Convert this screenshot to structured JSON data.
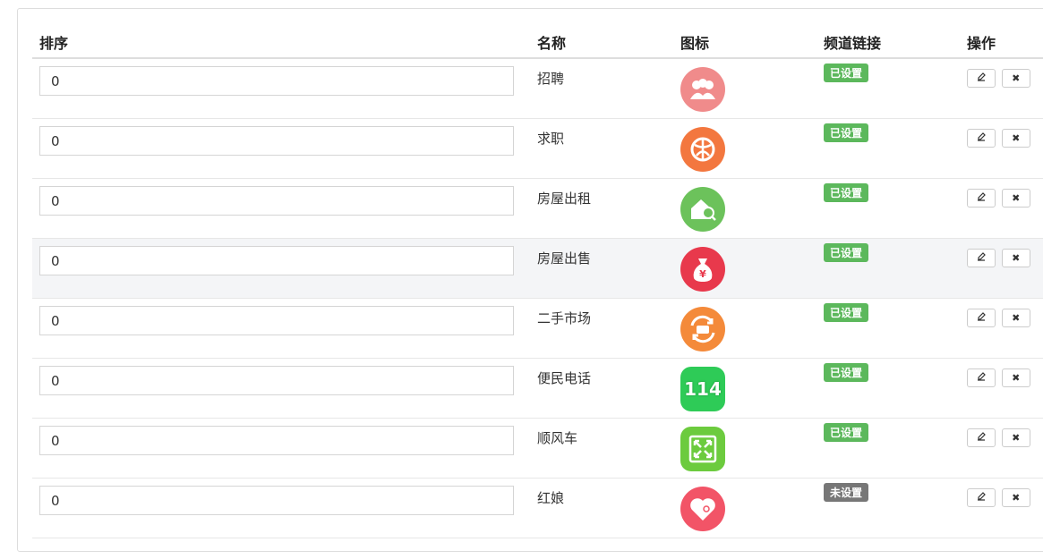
{
  "columns": {
    "order": "排序",
    "name": "名称",
    "icon": "图标",
    "link": "频道链接",
    "action": "操作"
  },
  "rows": [
    {
      "order": "0",
      "name": "招聘",
      "icon_name": "recruit-icon",
      "icon_color": "#f08b8b",
      "status": "已设置",
      "set": true
    },
    {
      "order": "0",
      "name": "求职",
      "icon_name": "job-search-icon",
      "icon_color": "#f3773f",
      "status": "已设置",
      "set": true
    },
    {
      "order": "0",
      "name": "房屋出租",
      "icon_name": "house-rent-icon",
      "icon_color": "#6cc25b",
      "status": "已设置",
      "set": true
    },
    {
      "order": "0",
      "name": "房屋出售",
      "icon_name": "house-sale-icon",
      "icon_color": "#e8394c",
      "status": "已设置",
      "set": true
    },
    {
      "order": "0",
      "name": "二手市场",
      "icon_name": "second-hand-market-icon",
      "icon_color": "#f48a3a",
      "status": "已设置",
      "set": true
    },
    {
      "order": "0",
      "name": "便民电话",
      "icon_name": "phone-114-icon",
      "icon_color": "#2ecb57",
      "status": "已设置",
      "set": true
    },
    {
      "order": "0",
      "name": "顺风车",
      "icon_name": "carpool-icon",
      "icon_color": "#6ccb3e",
      "status": "已设置",
      "set": true
    },
    {
      "order": "0",
      "name": "红娘",
      "icon_name": "matchmaker-icon",
      "icon_color": "#f25467",
      "status": "未设置",
      "set": false
    }
  ],
  "icon_glyphs": {
    "phone_114": "114",
    "yen": "¥"
  },
  "buttons": {
    "edit_icon": "edit-icon",
    "delete_icon": "delete-icon",
    "delete_glyph": "✖"
  }
}
